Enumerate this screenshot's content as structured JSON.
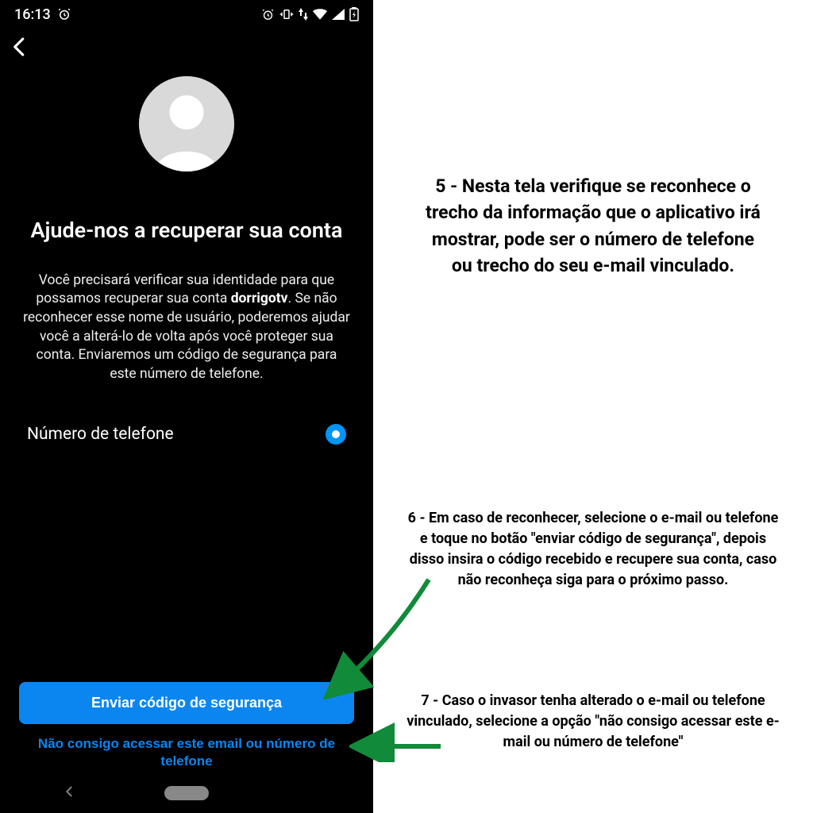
{
  "status": {
    "time": "16:13"
  },
  "screen": {
    "title": "Ajude-nos a recuperar sua conta",
    "body_pre": "Você precisará verificar sua identidade para que possamos recuperar sua conta ",
    "body_bold": "dorrigotv",
    "body_post": ". Se não reconhecer esse nome de usuário, poderemos ajudar você a alterá-lo de volta após você proteger sua conta. Enviaremos um código de segurança para este número de telefone.",
    "option_phone": "Número de telefone",
    "primary_button": "Enviar código de segurança",
    "cant_access": "Não consigo acessar este email ou número de telefone"
  },
  "instructions": {
    "step5": "5 - Nesta tela verifique se reconhece o trecho da informação que o aplicativo irá mostrar, pode ser o número de telefone ou trecho do seu e-mail vinculado.",
    "step6": "6 - Em caso de reconhecer, selecione o e-mail ou telefone e toque no botão \"enviar código de segurança\", depois disso insira o código recebido e recupere sua conta, caso não reconheça siga para o próximo passo.",
    "step7": "7 - Caso o invasor tenha alterado o e-mail ou telefone vinculado, selecione a opção \"não consigo acessar este e-mail ou número de telefone\""
  }
}
